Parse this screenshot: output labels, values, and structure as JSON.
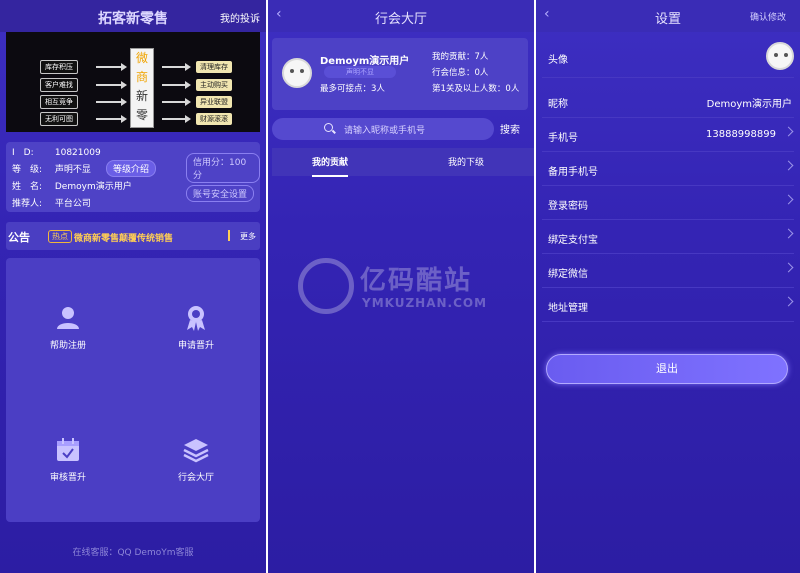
{
  "panel1": {
    "title": "拓客新零售",
    "complaint": "我的投诉",
    "banner": {
      "left_labels": [
        "库存积压",
        "客户难找",
        "相互竞争",
        "无利可图"
      ],
      "center_chars": [
        "微",
        "商",
        "新",
        "零",
        "售"
      ],
      "right_labels": [
        "清理库存",
        "主动购买",
        "异业联盟",
        "财源滚滚"
      ]
    },
    "info": {
      "id_label": "I　D:",
      "id_value": "10821009",
      "level_label": "等　级:",
      "level_value": "声明不显",
      "level_btn": "等级介绍",
      "credit": "信用分：100分",
      "name_label": "姓　名:",
      "name_value": "Demoym演示用户",
      "security_btn": "账号安全设置",
      "referrer_label": "推荐人:",
      "referrer_value": "平台公司"
    },
    "notice": {
      "title": "公告",
      "hot": "热点",
      "message": "微商新零售颠覆传统销售",
      "more": "更多"
    },
    "grid": [
      {
        "label": "帮助注册",
        "icon": "user-icon"
      },
      {
        "label": "申请晋升",
        "icon": "medal-icon"
      },
      {
        "label": "审核晋升",
        "icon": "calendar-check-icon"
      },
      {
        "label": "行会大厅",
        "icon": "layers-icon"
      }
    ],
    "footer": "在线客服：QQ DemoYm客服"
  },
  "panel2": {
    "title": "行会大厅",
    "user": {
      "name": "Demoym演示用户",
      "tag": "声明不显",
      "max_orders": "最多可接点：3人",
      "my_contribution": "我的贡献：7人",
      "guild_info": "行会信息：0人",
      "level1_count": "第1关及以上人数：0人"
    },
    "search_placeholder": "请输入昵称或手机号",
    "search_btn": "搜索",
    "tabs": [
      "我的贡献",
      "我的下级"
    ],
    "watermark": {
      "big": "亿码酷站",
      "small": "YMKUZHAN.COM"
    }
  },
  "panel3": {
    "title": "设置",
    "confirm": "确认修改",
    "rows": [
      {
        "label": "头像",
        "value": ""
      },
      {
        "label": "昵称",
        "value": "Demoym演示用户"
      },
      {
        "label": "手机号",
        "value": "13888998899"
      },
      {
        "label": "备用手机号",
        "value": ""
      },
      {
        "label": "登录密码",
        "value": ""
      },
      {
        "label": "绑定支付宝",
        "value": ""
      },
      {
        "label": "绑定微信",
        "value": ""
      },
      {
        "label": "地址管理",
        "value": ""
      }
    ],
    "logout": "退出"
  }
}
